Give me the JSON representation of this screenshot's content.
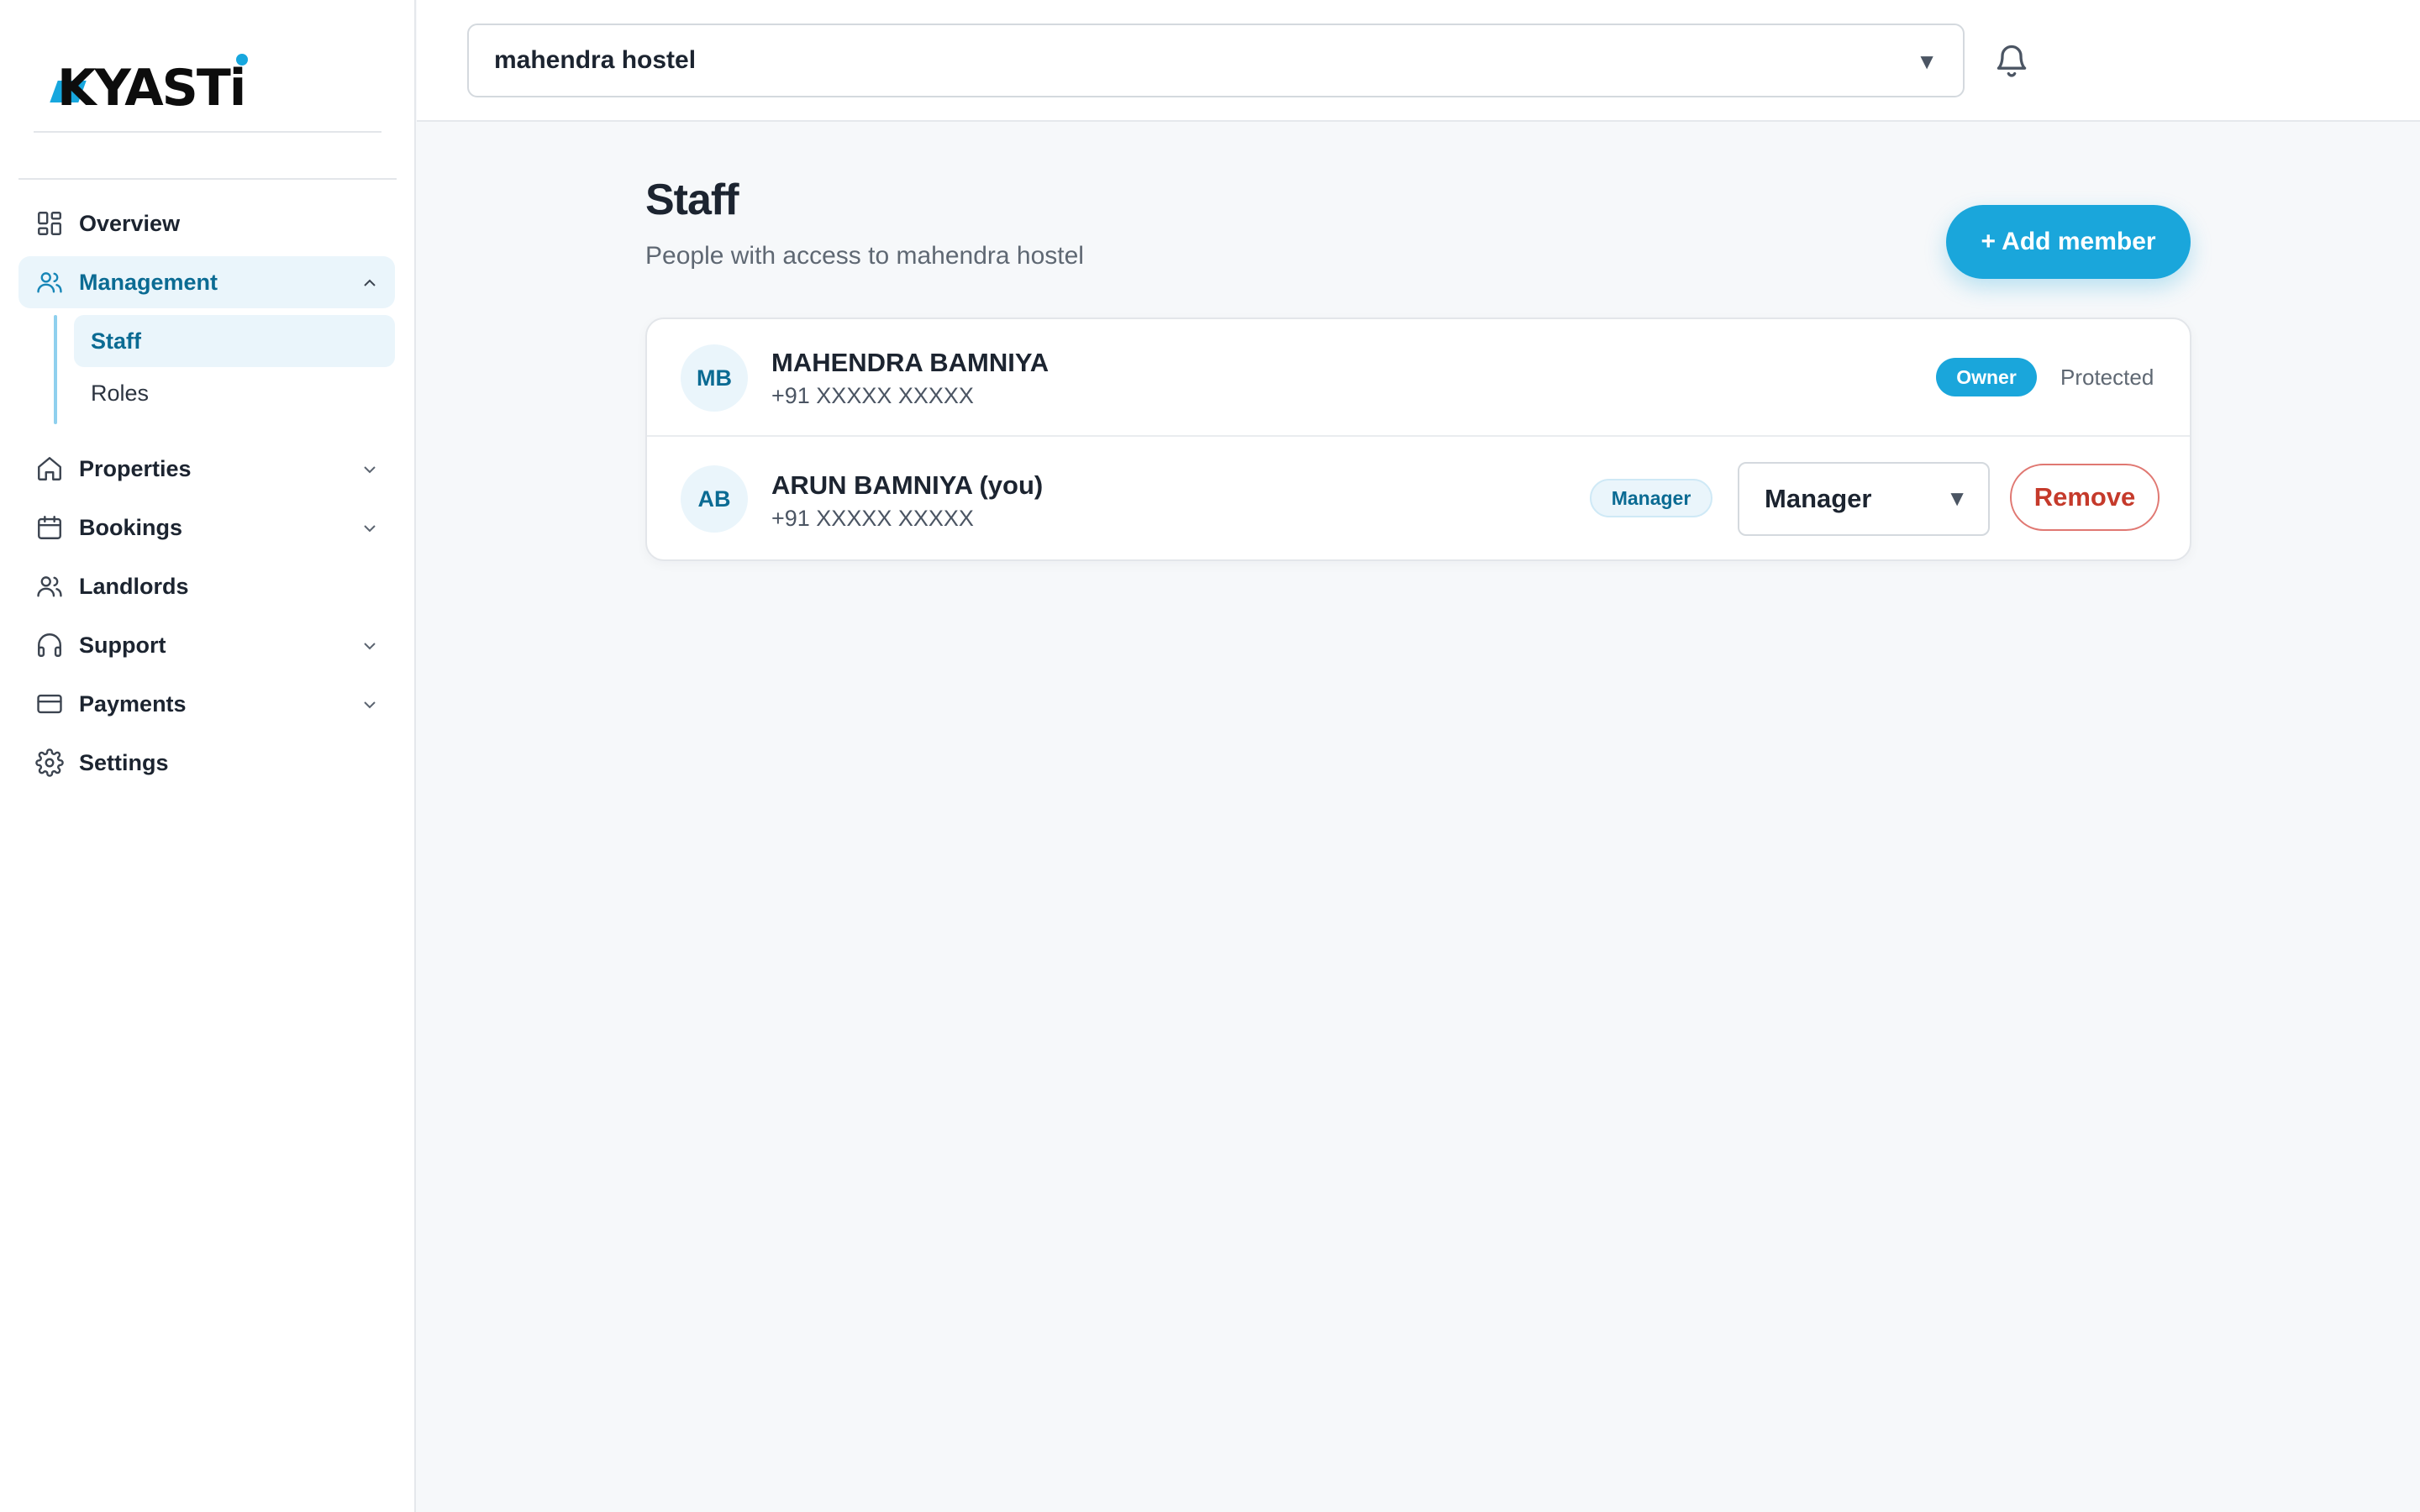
{
  "brand": {
    "logo_text": "KYASTi",
    "accent_color": "#1aa6db"
  },
  "sidebar": {
    "items": [
      {
        "label": "Overview",
        "icon": "grid-icon"
      },
      {
        "label": "Management",
        "icon": "users-icon",
        "expanded": true,
        "children": [
          {
            "label": "Staff",
            "active": true
          },
          {
            "label": "Roles"
          }
        ]
      },
      {
        "label": "Properties",
        "icon": "home-icon"
      },
      {
        "label": "Bookings",
        "icon": "calendar-icon"
      },
      {
        "label": "Landlords",
        "icon": "users-icon"
      },
      {
        "label": "Support",
        "icon": "headphones-icon"
      },
      {
        "label": "Payments",
        "icon": "credit-card-icon"
      },
      {
        "label": "Settings",
        "icon": "gear-icon"
      }
    ]
  },
  "topbar": {
    "property_value": "mahendra hostel"
  },
  "main": {
    "title": "Staff",
    "subtitle": "People with access to mahendra hostel",
    "add_button": "+ Add member",
    "members": [
      {
        "initials": "MB",
        "name": "MAHENDRA BAMNIYA",
        "phone": "+91 XXXXX XXXXX",
        "badge": "Owner",
        "status": "Protected"
      },
      {
        "initials": "AB",
        "name": "ARUN BAMNIYA (you)",
        "phone": "+91 XXXXX XXXXX",
        "badge": "Manager",
        "role_value": "Manager",
        "remove_label": "Remove"
      }
    ]
  }
}
